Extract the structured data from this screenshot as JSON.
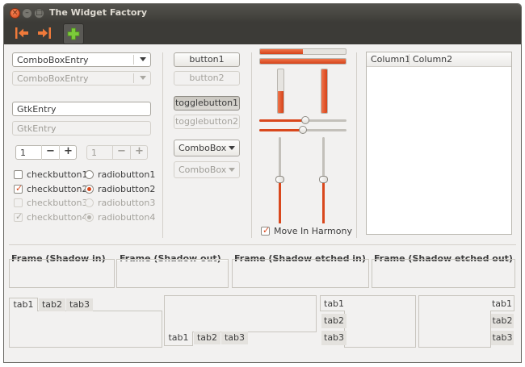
{
  "window": {
    "title": "The Widget Factory"
  },
  "titlebar": {
    "close": "×",
    "minimize": "–",
    "maximize": "□"
  },
  "toolbar": {
    "items": [
      {
        "icon": "go-first-icon"
      },
      {
        "icon": "go-last-icon"
      },
      {
        "icon": "add-icon"
      }
    ]
  },
  "colors": {
    "accent": "#d9481d",
    "window_bg": "#f2f1f0",
    "titlebar_bg": "#3c3b37"
  },
  "left": {
    "combo_entry": {
      "value": "ComboBoxEntry"
    },
    "combo_entry_disabled": {
      "value": "ComboBoxEntry"
    },
    "entry": {
      "value": "GtkEntry"
    },
    "entry_disabled": {
      "value": "GtkEntry"
    },
    "spin": {
      "value": "1",
      "minus": "−",
      "plus": "+"
    },
    "spin_disabled": {
      "value": "1",
      "minus": "−",
      "plus": "+"
    },
    "checks": [
      {
        "label": "checkbutton1",
        "checked": false,
        "enabled": true
      },
      {
        "label": "checkbutton2",
        "checked": true,
        "enabled": true
      },
      {
        "label": "checkbutton3",
        "checked": false,
        "enabled": false
      },
      {
        "label": "checkbutton4",
        "checked": true,
        "enabled": false
      }
    ],
    "radios": [
      {
        "label": "radiobutton1",
        "selected": false,
        "enabled": true
      },
      {
        "label": "radiobutton2",
        "selected": true,
        "enabled": true
      },
      {
        "label": "radiobutton3",
        "selected": false,
        "enabled": false
      },
      {
        "label": "radiobutton4",
        "selected": true,
        "enabled": false
      }
    ],
    "check_mark": "✓"
  },
  "buttons": {
    "button1": "button1",
    "button2": "button2",
    "togglebutton1": "togglebutton1",
    "togglebutton2": "togglebutton2",
    "combobox": "ComboBox",
    "combobox_disabled": "ComboBox"
  },
  "ranges": {
    "hprogress": [
      0.5,
      1.0
    ],
    "vprogress": [
      0.5,
      1.0
    ],
    "hscales": [
      0.5,
      0.47
    ],
    "vscales": [
      0.5,
      0.5
    ],
    "move_in_harmony": {
      "label": "Move In Harmony",
      "checked": true
    }
  },
  "tree": {
    "columns": [
      "Column1",
      "Column2"
    ]
  },
  "frames": [
    {
      "label": "Frame (Shadow in)"
    },
    {
      "label": "Frame (Shadow out)"
    },
    {
      "label": "Frame (Shadow etched in)"
    },
    {
      "label": "Frame (Shadow etched out)"
    }
  ],
  "notebooks": [
    {
      "position": "top",
      "tabs": [
        "tab1",
        "tab2",
        "tab3"
      ],
      "active": 0
    },
    {
      "position": "bottom",
      "tabs": [
        "tab1",
        "tab2",
        "tab3"
      ],
      "active": 0
    },
    {
      "position": "left",
      "tabs": [
        "tab1",
        "tab2",
        "tab3"
      ],
      "active": 0
    },
    {
      "position": "right",
      "tabs": [
        "tab1",
        "tab2",
        "tab3"
      ],
      "active": 0
    }
  ]
}
